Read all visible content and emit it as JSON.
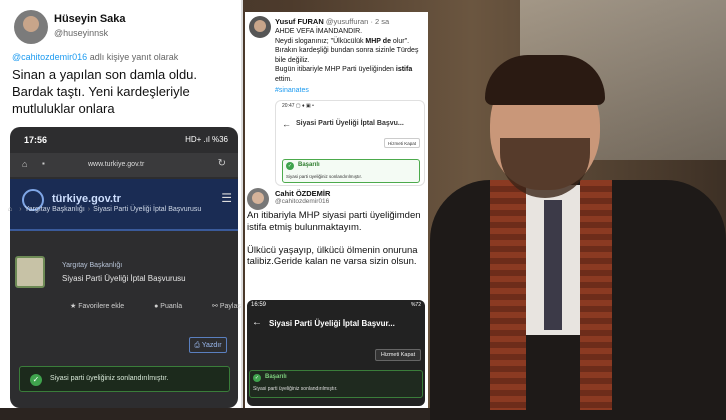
{
  "tweet1": {
    "name": "Hüseyin Saka",
    "handle": "@huseyinnsk",
    "reply_mention": "@cahitozdemir016",
    "reply_suffix": " adlı kişiye yanıt olarak",
    "text": "Sinan a yapılan son damla oldu. Bardak taştı. Yeni kardeşleriyle mutluluklar onlara",
    "phone": {
      "time": "17:56",
      "status_right": "HD+ .ıl %36",
      "url": "www.turkiye.gov.tr",
      "logo_text": "türkiye.gov.tr",
      "breadcrumb_1": "Yargıtay Başkanlığı",
      "breadcrumb_2": "Siyasi Parti Üyeliği İptal Başvurusu",
      "card_sub": "Yargıtay Başkanlığı",
      "card_title": "Siyasi Parti Üyeliği İptal Başvurusu",
      "action_favorite": "Favorilere ekle",
      "action_rate": "Puanla",
      "action_share": "Paylaş",
      "print_label": "Yazdır",
      "success_text": "Siyasi parti üyeliğiniz sonlandırılmıştır."
    }
  },
  "tweet2": {
    "name": "Yusuf FURAN",
    "handle": "@yusuffuran",
    "time": "· 2 sa",
    "line1": "AHDE VEFA İMANDANDIR.",
    "line2_pre": "Neydi sloganınız; \"Ülkücülük ",
    "line2_brand": "MHP de",
    "line2_post": " olur\".",
    "line3": "Bırakın kardeşliği bundan sonra sizinle Türdeş bile değiliz.",
    "line4_pre": "Bugün itibariyle MHP Parti üyeliğinden ",
    "line4_brand": "istifa",
    "line4_post": " ettim.",
    "hashtag": "#sinanates",
    "screenshot": {
      "status": "20:47 ▢ ♦ ▣ •",
      "title": "Siyasi Parti Üyeliği İptal Başvu...",
      "button": "Hizmeti Kapat",
      "ok_title": "Başarılı",
      "ok_desc": "Siyasi parti üyeliğiniz sonlandırılmıştır."
    }
  },
  "tweet3": {
    "name": "Cahit ÖZDEMİR",
    "handle": "@cahitozdemir016",
    "text": "An itibariyla MHP siyasi parti üyeliğimden istifa etmiş bulunmaktayım.\n\nÜlkücü yaşayıp, ülkücü ölmenin onuruna talibiz.Geride kalan ne varsa sizin olsun.",
    "screenshot": {
      "time": "16:59",
      "status_right": "%72",
      "title": "Siyasi Parti Üyeliği İptal Başvur...",
      "button": "Hizmeti Kapat",
      "ok_title": "Başarılı",
      "ok_desc": "Siyasi parti üyeliğiniz sonlandırılmıştır."
    }
  }
}
